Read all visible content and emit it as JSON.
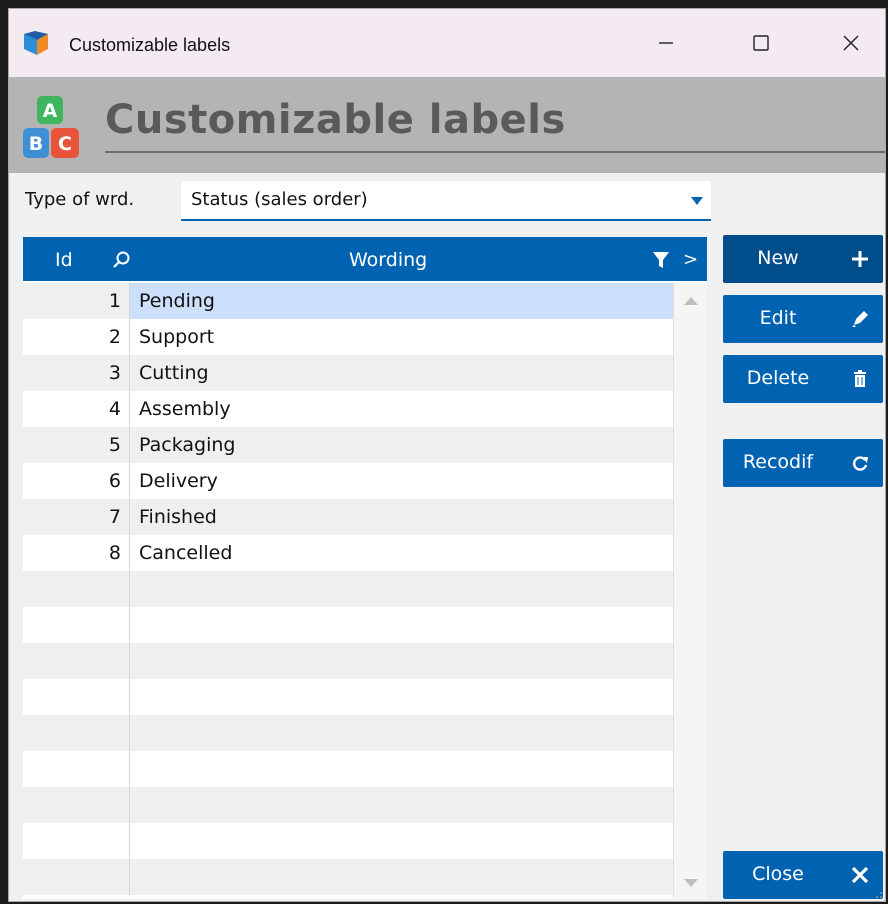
{
  "window": {
    "title": "Customizable labels",
    "icons": {
      "app": "app-logo-icon",
      "minimize": "minimize-icon",
      "maximize": "maximize-icon",
      "close": "close-icon"
    },
    "controls": {
      "minimize_glyph": "—",
      "maximize_glyph": "☐",
      "close_glyph": "✕"
    }
  },
  "header": {
    "title": "Customizable labels",
    "icon": "abc-blocks-icon",
    "icon_letters": [
      "A",
      "B",
      "C"
    ]
  },
  "filter": {
    "label": "Type of wrd.",
    "value": "Status (sales order)"
  },
  "grid": {
    "columns": {
      "id": "Id",
      "wording": "Wording"
    },
    "header_icons": [
      "search-icon",
      "filter-icon",
      "chevron-right-icon"
    ],
    "more_glyph": ">",
    "selected_row": 0,
    "rows": [
      {
        "id": "1",
        "wording": "Pending"
      },
      {
        "id": "2",
        "wording": "Support"
      },
      {
        "id": "3",
        "wording": "Cutting"
      },
      {
        "id": "4",
        "wording": "Assembly"
      },
      {
        "id": "5",
        "wording": "Packaging"
      },
      {
        "id": "6",
        "wording": "Delivery"
      },
      {
        "id": "7",
        "wording": "Finished"
      },
      {
        "id": "8",
        "wording": "Cancelled"
      }
    ],
    "empty_row_count": 9
  },
  "buttons": {
    "new": {
      "label": "New",
      "icon": "plus-icon"
    },
    "edit": {
      "label": "Edit",
      "icon": "pencil-icon"
    },
    "delete": {
      "label": "Delete",
      "icon": "trash-icon"
    },
    "recodif": {
      "label": "Recodif",
      "icon": "refresh-icon"
    },
    "close": {
      "label": "Close",
      "icon": "close-icon"
    }
  },
  "colors": {
    "accent": "#0063b1",
    "accent_dark": "#004d8c",
    "selection": "#cce0fb",
    "header_band": "#b4b4b4",
    "titlebar": "#f4eaf2"
  }
}
